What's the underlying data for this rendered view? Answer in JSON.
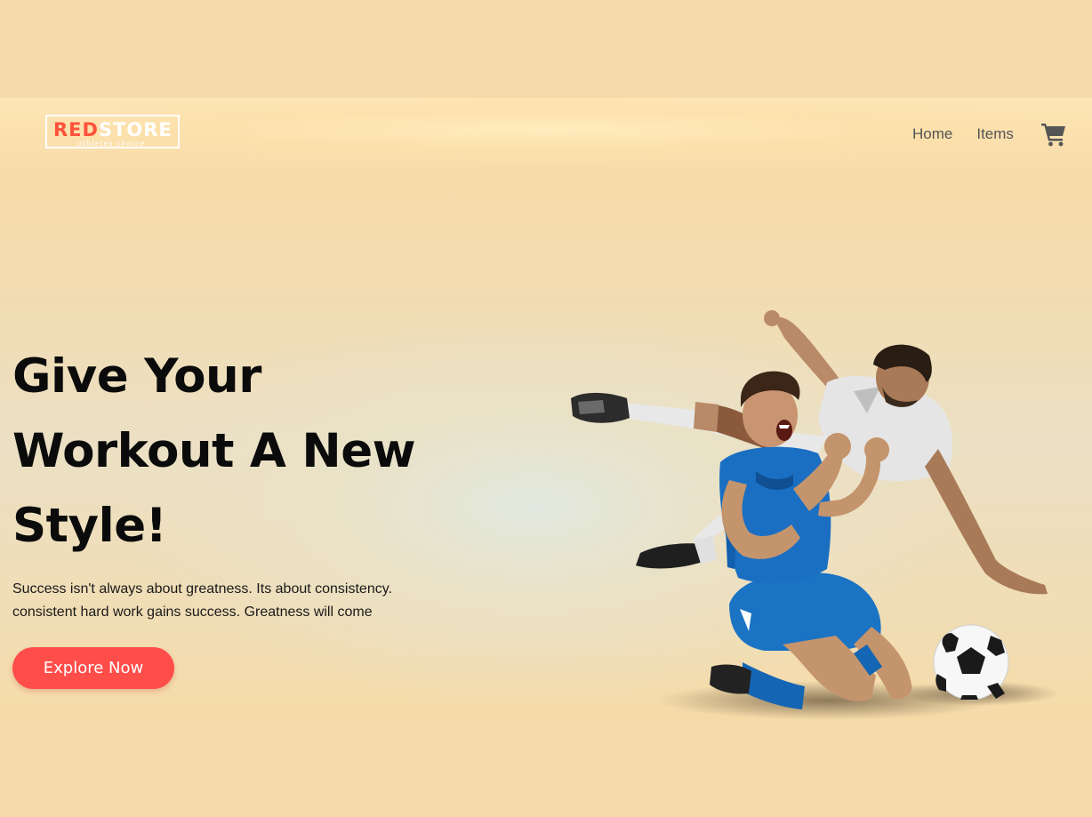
{
  "navbar": {
    "logo": {
      "brand_red": "RED",
      "brand_white": "STORE",
      "tagline": "athletes choice"
    },
    "links": [
      {
        "label": "Home"
      },
      {
        "label": "Items"
      }
    ],
    "cart_icon": "shopping-cart-icon"
  },
  "hero": {
    "headline": "Give Your Workout A New Style!",
    "subtext": "Success isn't always about greatness. Its about consistency. consistent hard work gains success. Greatness will come",
    "button_label": "Explore Now",
    "image": "soccer-players-celebrating-image"
  },
  "colors": {
    "accent": "#ff523b",
    "button": "#ff4d4a",
    "background": "#f5dbab",
    "nav_text": "#555555",
    "headline": "#0b0b0b"
  }
}
